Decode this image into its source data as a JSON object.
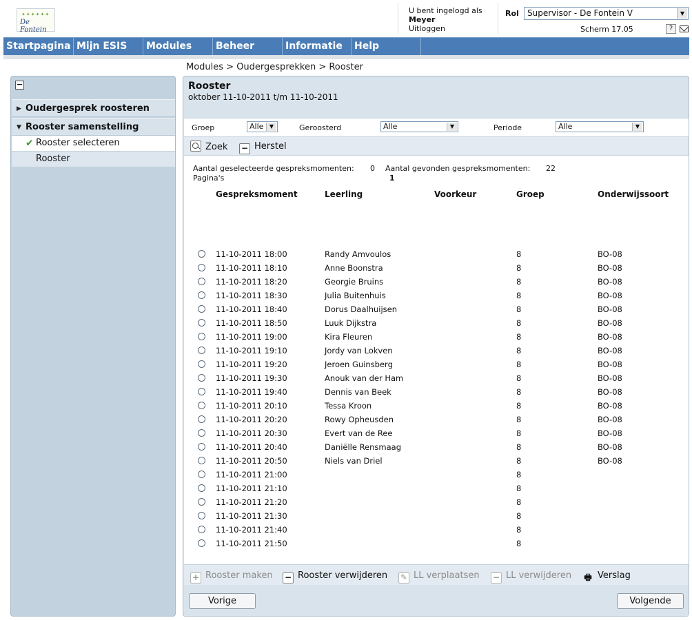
{
  "header": {
    "logo_text": "De Fontein",
    "logged_in_as": "U bent ingelogd als",
    "user_name": "Meyer",
    "logout": "Uitloggen",
    "role_label": "Rol",
    "role_value": "Supervisor - De Fontein V",
    "screen": "Scherm 17.05",
    "help": "?"
  },
  "nav": {
    "items": [
      "Startpagina",
      "Mijn ESIS",
      "Modules",
      "Beheer",
      "Informatie",
      "Help"
    ]
  },
  "breadcrumb": "Modules > Oudergesprekken > Rooster",
  "sidebar": {
    "collapse": "−",
    "section1": "Oudergesprek roosteren",
    "section2": "Rooster samenstelling",
    "item_selected": "Rooster selecteren",
    "item_other": "Rooster"
  },
  "main": {
    "title": "Rooster",
    "subtitle": "oktober 11-10-2011 t/m 11-10-2011",
    "filters": {
      "groep_label": "Groep",
      "groep_value": "Alle",
      "geroosterd_label": "Geroosterd",
      "geroosterd_value": "Alle",
      "periode_label": "Periode",
      "periode_value": "Alle"
    },
    "actions": {
      "zoek": "Zoek",
      "herstel": "Herstel"
    },
    "stats": {
      "selected_label": "Aantal geselecteerde gespreksmomenten:",
      "selected_value": "0",
      "found_label": "Aantal gevonden gespreksmomenten:",
      "found_value": "22",
      "pages_label": "Pagina's",
      "pages_value": "1"
    },
    "columns": [
      "Gespreksmoment",
      "Leerling",
      "Voorkeur",
      "Groep",
      "Onderwijssoort"
    ],
    "rows": [
      {
        "moment": "11-10-2011 18:00",
        "leerling": "Randy Amvoulos",
        "voorkeur": "",
        "groep": "8",
        "soort": "BO-08"
      },
      {
        "moment": "11-10-2011 18:10",
        "leerling": "Anne Boonstra",
        "voorkeur": "",
        "groep": "8",
        "soort": "BO-08"
      },
      {
        "moment": "11-10-2011 18:20",
        "leerling": "Georgie Bruins",
        "voorkeur": "",
        "groep": "8",
        "soort": "BO-08"
      },
      {
        "moment": "11-10-2011 18:30",
        "leerling": "Julia Buitenhuis",
        "voorkeur": "",
        "groep": "8",
        "soort": "BO-08"
      },
      {
        "moment": "11-10-2011 18:40",
        "leerling": "Dorus Daalhuijsen",
        "voorkeur": "",
        "groep": "8",
        "soort": "BO-08"
      },
      {
        "moment": "11-10-2011 18:50",
        "leerling": "Luuk Dijkstra",
        "voorkeur": "",
        "groep": "8",
        "soort": "BO-08"
      },
      {
        "moment": "11-10-2011 19:00",
        "leerling": "Kira Fleuren",
        "voorkeur": "",
        "groep": "8",
        "soort": "BO-08"
      },
      {
        "moment": "11-10-2011 19:10",
        "leerling": "Jordy van Lokven",
        "voorkeur": "",
        "groep": "8",
        "soort": "BO-08"
      },
      {
        "moment": "11-10-2011 19:20",
        "leerling": "Jeroen Guinsberg",
        "voorkeur": "",
        "groep": "8",
        "soort": "BO-08"
      },
      {
        "moment": "11-10-2011 19:30",
        "leerling": "Anouk van der Ham",
        "voorkeur": "",
        "groep": "8",
        "soort": "BO-08"
      },
      {
        "moment": "11-10-2011 19:40",
        "leerling": "Dennis van Beek",
        "voorkeur": "",
        "groep": "8",
        "soort": "BO-08"
      },
      {
        "moment": "11-10-2011 20:10",
        "leerling": "Tessa Kroon",
        "voorkeur": "",
        "groep": "8",
        "soort": "BO-08"
      },
      {
        "moment": "11-10-2011 20:20",
        "leerling": "Rowy Opheusden",
        "voorkeur": "",
        "groep": "8",
        "soort": "BO-08"
      },
      {
        "moment": "11-10-2011 20:30",
        "leerling": "Evert van de Ree",
        "voorkeur": "",
        "groep": "8",
        "soort": "BO-08"
      },
      {
        "moment": "11-10-2011 20:40",
        "leerling": "Daniëlle Rensmaag",
        "voorkeur": "",
        "groep": "8",
        "soort": "BO-08"
      },
      {
        "moment": "11-10-2011 20:50",
        "leerling": "Niels van Driel",
        "voorkeur": "",
        "groep": "8",
        "soort": "BO-08"
      },
      {
        "moment": "11-10-2011 21:00",
        "leerling": "",
        "voorkeur": "",
        "groep": "8",
        "soort": ""
      },
      {
        "moment": "11-10-2011 21:10",
        "leerling": "",
        "voorkeur": "",
        "groep": "8",
        "soort": ""
      },
      {
        "moment": "11-10-2011 21:20",
        "leerling": "",
        "voorkeur": "",
        "groep": "8",
        "soort": ""
      },
      {
        "moment": "11-10-2011 21:30",
        "leerling": "",
        "voorkeur": "",
        "groep": "8",
        "soort": ""
      },
      {
        "moment": "11-10-2011 21:40",
        "leerling": "",
        "voorkeur": "",
        "groep": "8",
        "soort": ""
      },
      {
        "moment": "11-10-2011 21:50",
        "leerling": "",
        "voorkeur": "",
        "groep": "8",
        "soort": ""
      }
    ],
    "bottom_actions": {
      "rooster_maken": "Rooster maken",
      "rooster_verwijderen": "Rooster verwijderen",
      "ll_verplaatsen": "LL verplaatsen",
      "ll_verwijderen": "LL verwijderen",
      "verslag": "Verslag"
    },
    "footer": {
      "prev": "Vorige",
      "next": "Volgende"
    }
  },
  "colors": {
    "nav_bg": "#4a7db7",
    "panel_bg": "#d9e3ec",
    "sidebar_bg": "#c3d2df",
    "check": "#3c9a2d"
  },
  "icons": [
    "logo",
    "chevron-down-icon",
    "help-icon",
    "mail-icon",
    "collapse-icon",
    "triangle-right-icon",
    "triangle-down-icon",
    "check-icon",
    "search-icon",
    "minus-icon",
    "plus-icon",
    "pencil-icon",
    "printer-icon",
    "radio-icon"
  ]
}
